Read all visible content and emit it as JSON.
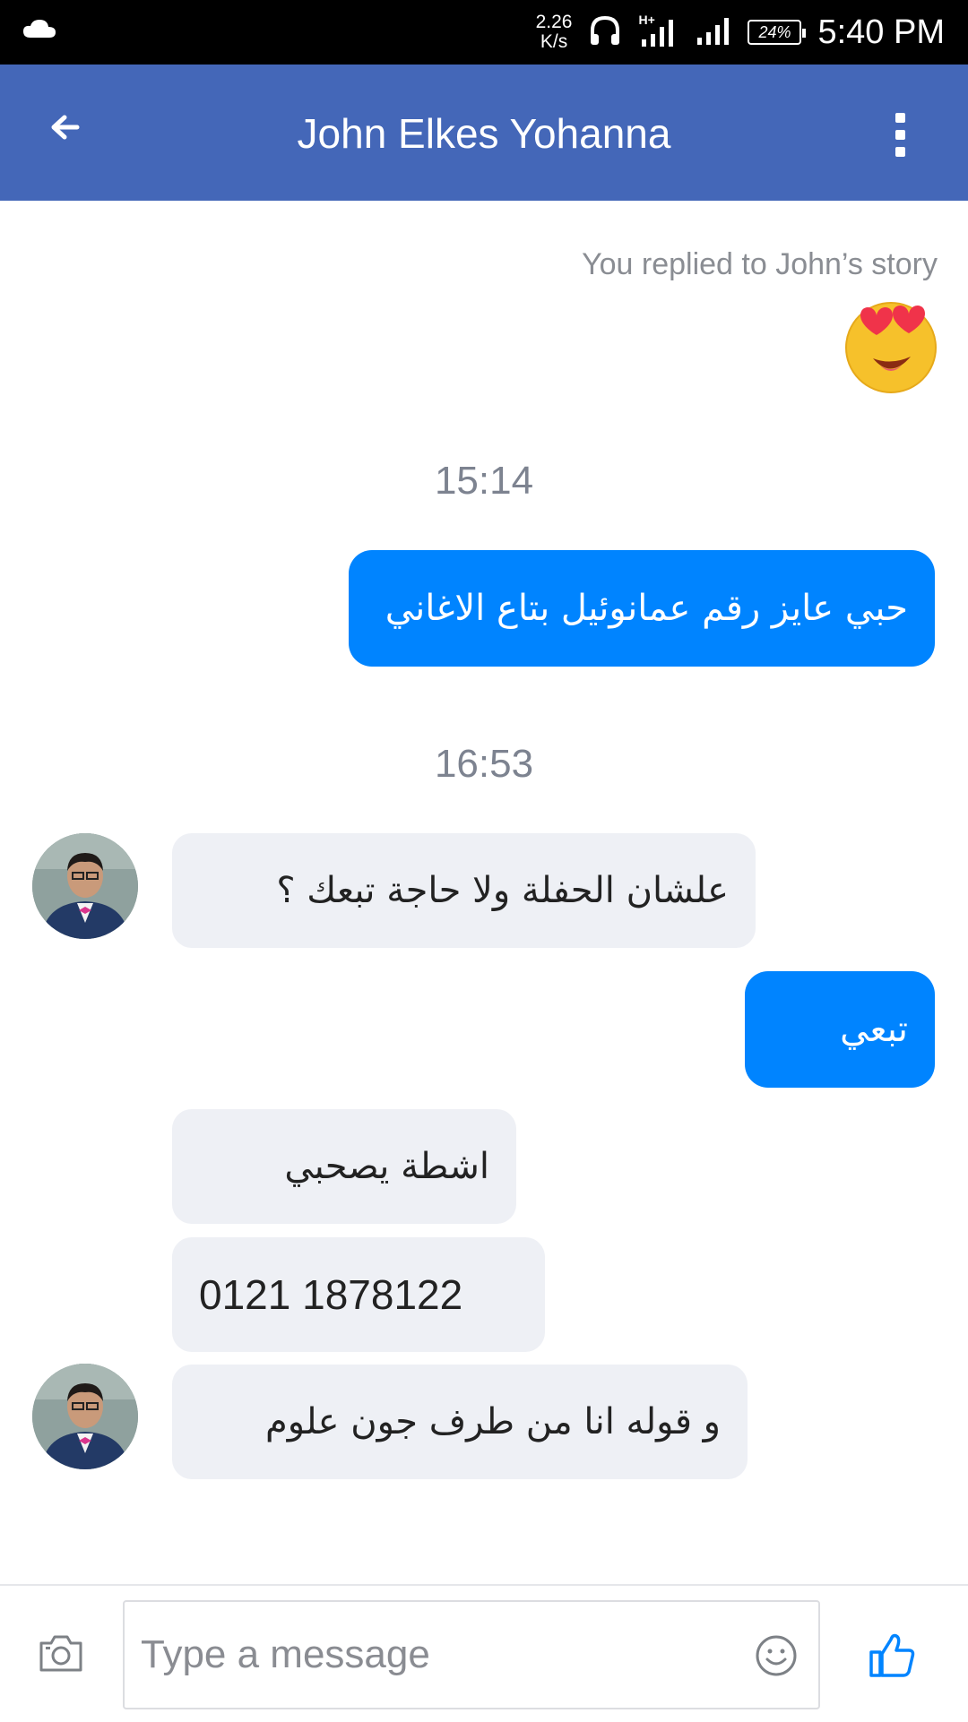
{
  "status_bar": {
    "network_speed": "2.26",
    "network_speed_unit": "K/s",
    "network_type": "H+",
    "battery": "24%",
    "clock": "5:40 PM",
    "icons": [
      "cloud-icon",
      "headphones-icon",
      "signal-icon",
      "signal-icon",
      "battery-icon"
    ]
  },
  "header": {
    "title": "John Elkes Yohanna",
    "back_icon": "arrow-left-icon",
    "menu_icon": "more-vertical-icon",
    "background": "#4467b8"
  },
  "conversation": {
    "story_note": "You replied to John’s story",
    "story_reply_emoji": "heart-eyes-emoji",
    "timestamps": [
      "15:14",
      "16:53"
    ],
    "messages": [
      {
        "direction": "outgoing",
        "text": "حبي عايز رقم عمانوئيل بتاع الاغاني"
      },
      {
        "direction": "incoming",
        "text": "علشان الحفلة ولا حاجة تبعك ؟",
        "avatar": true
      },
      {
        "direction": "outgoing",
        "text": "تبعي"
      },
      {
        "direction": "incoming",
        "text": "اشطة يصحبي",
        "avatar": false
      },
      {
        "direction": "incoming",
        "text": "0121 1878122",
        "avatar": false
      },
      {
        "direction": "incoming",
        "text": "و قوله انا من طرف جون علوم",
        "avatar": true
      }
    ],
    "outgoing_color": "#0084ff",
    "incoming_color": "#eef0f5"
  },
  "composer": {
    "placeholder": "Type a message",
    "value": "",
    "camera_icon": "camera-icon",
    "emoji_icon": "smiley-icon",
    "like_icon": "thumbs-up-icon",
    "accent": "#0084ff"
  }
}
